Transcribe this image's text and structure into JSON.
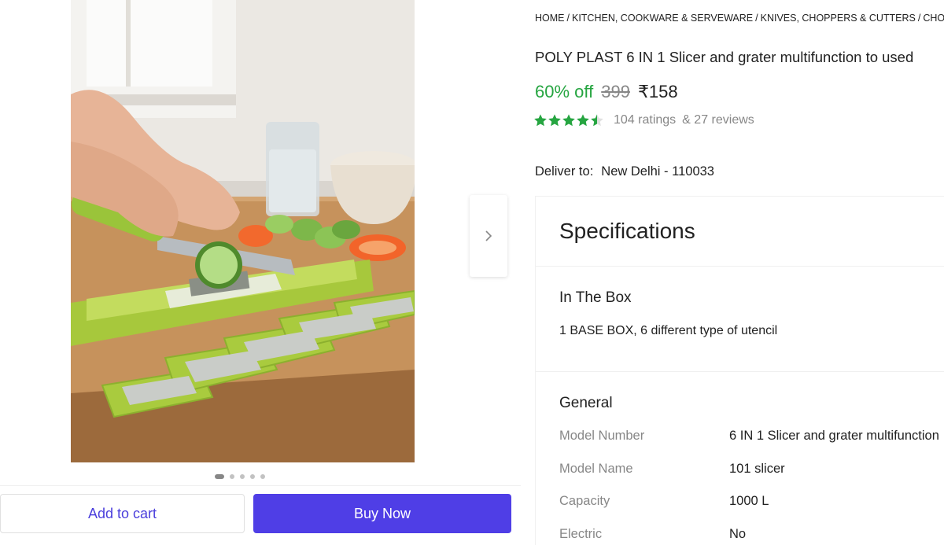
{
  "breadcrumb": [
    "HOME",
    "KITCHEN, COOKWARE & SERVEWARE",
    "KNIVES, CHOPPERS & CUTTERS",
    "CHOPPE"
  ],
  "product": {
    "title": "POLY PLAST 6 IN 1 Slicer and grater multifunction to used",
    "discount": "60% off",
    "mrp": "399",
    "price": "₹158",
    "rating_stars": 4.5,
    "ratings_text": "104 ratings",
    "reviews_text": "& 27 reviews"
  },
  "delivery": {
    "label": "Deliver to:",
    "location": "New Delhi - 110033"
  },
  "gallery": {
    "dots": 5,
    "active_dot": 0
  },
  "actions": {
    "add_to_cart": "Add to cart",
    "buy_now": "Buy Now"
  },
  "specifications": {
    "heading": "Specifications",
    "in_the_box": {
      "title": "In The Box",
      "text": "1 BASE BOX, 6 different type of utencil"
    },
    "general": {
      "title": "General",
      "rows": [
        {
          "key": "Model Number",
          "value": "6 IN 1 Slicer and grater multifunction"
        },
        {
          "key": "Model Name",
          "value": "101 slicer"
        },
        {
          "key": "Capacity",
          "value": "1000 L"
        },
        {
          "key": "Electric",
          "value": "No"
        }
      ]
    }
  },
  "colors": {
    "accent": "#4f3ee6",
    "discount": "#26a541",
    "muted": "#878787",
    "star": "#26a541"
  },
  "icons": {
    "next": "chevron-right-icon",
    "star": "star-icon"
  }
}
